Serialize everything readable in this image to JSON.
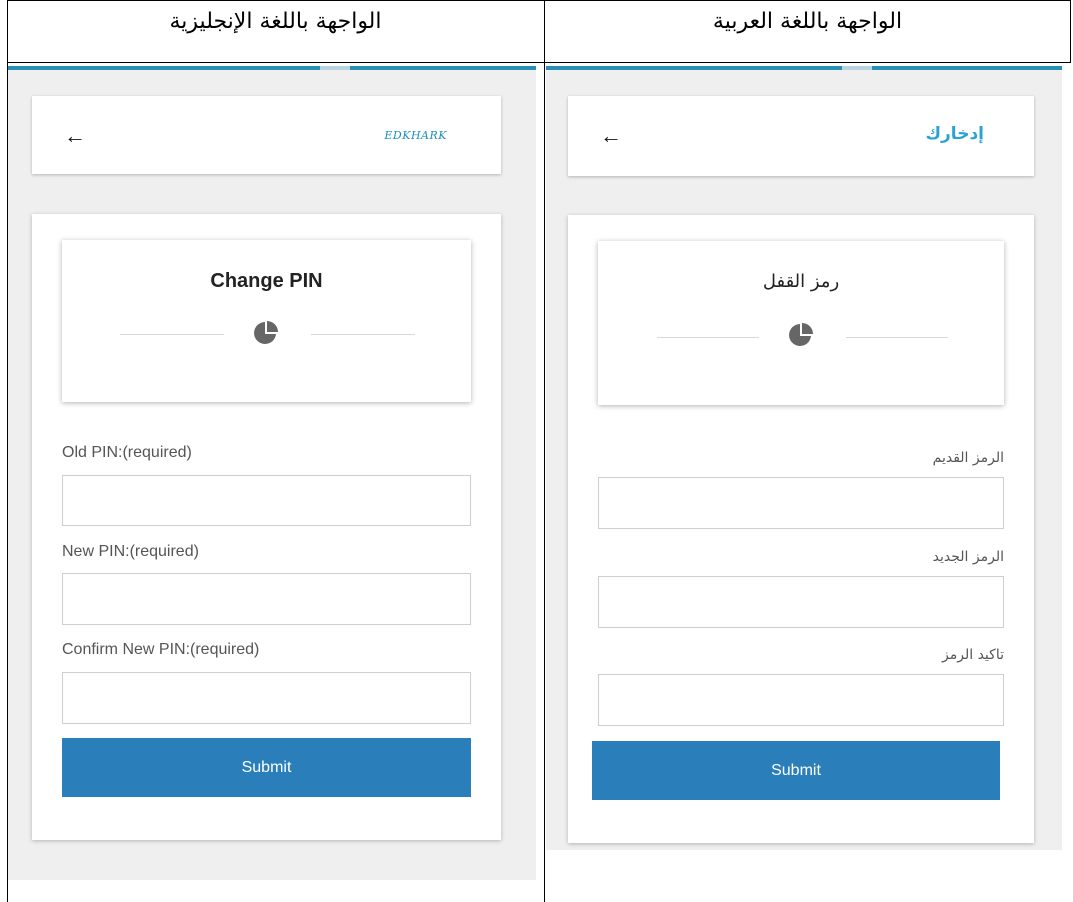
{
  "headers": {
    "left": "الواجهة باللغة الإنجليزية",
    "right": "الواجهة باللغة العربية"
  },
  "english": {
    "logo": "EDKHARK",
    "title": "Change PIN",
    "fields": [
      {
        "label": "Old PIN:(required)",
        "value": ""
      },
      {
        "label": "New PIN:(required)",
        "value": ""
      },
      {
        "label": "Confirm New PIN:(required)",
        "value": ""
      }
    ],
    "submit_label": "Submit"
  },
  "arabic": {
    "logo": "إدخارك",
    "title": "رمز القفل",
    "fields": [
      {
        "label": "الرمز القديم",
        "value": ""
      },
      {
        "label": "الرمز الجديد",
        "value": ""
      },
      {
        "label": "تاكيد الرمز",
        "value": ""
      }
    ],
    "submit_label": "Submit"
  },
  "icons": {
    "back": "arrow-left-icon",
    "section": "pie-chart-icon"
  },
  "colors": {
    "accent_bar": "#2a8fb4",
    "submit_button": "#2a7fba",
    "background": "#efefef"
  }
}
